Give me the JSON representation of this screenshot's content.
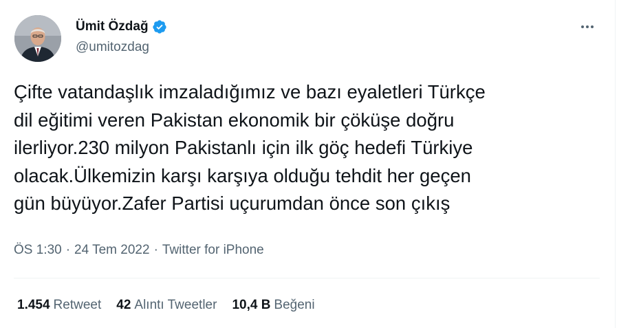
{
  "author": {
    "display_name": "Ümit Özdağ",
    "handle": "@umitozdag",
    "verified": true,
    "verified_color": "#1d9bf0"
  },
  "icons": {
    "more": "more-horizontal-icon",
    "verified": "verified-badge-icon"
  },
  "tweet": {
    "text": "Çifte vatandaşlık imzaladığımız ve bazı eyaletleri Türkçe\ndil eğitimi veren Pakistan ekonomik bir çöküşe doğru\nilerliyor.230 milyon Pakistanlı için ilk göç hedefi Türkiye\nolacak.Ülkemizin karşı karşıya olduğu tehdit her geçen\ngün büyüyor.Zafer Partisi uçurumdan önce son çıkış"
  },
  "meta": {
    "time": "ÖS 1:30",
    "separator": "·",
    "date": "24 Tem 2022",
    "source": "Twitter for iPhone"
  },
  "stats": {
    "retweets": {
      "count": "1.454",
      "label": "Retweet"
    },
    "quotes": {
      "count": "42",
      "label": "Alıntı Tweetler"
    },
    "likes": {
      "count": "10,4 B",
      "label": "Beğeni"
    }
  },
  "colors": {
    "text_primary": "#0f1419",
    "text_secondary": "#536471",
    "border": "#eff3f4"
  }
}
